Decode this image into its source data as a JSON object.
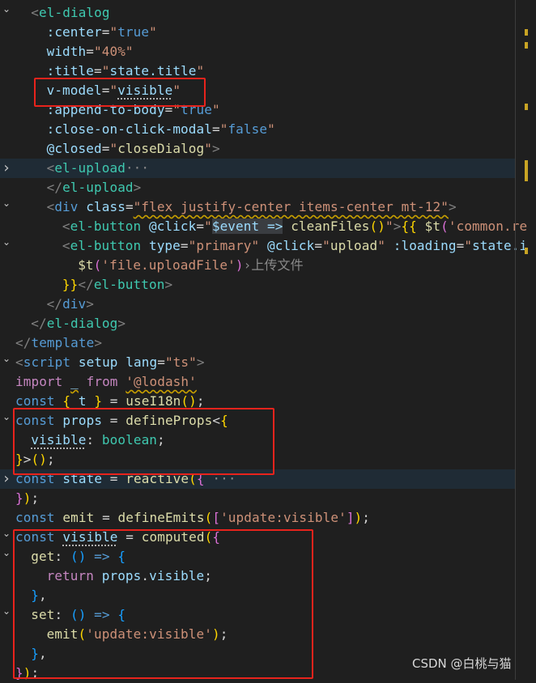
{
  "editor": {
    "lines": [
      {
        "f": "open",
        "i": 2,
        "t": [
          [
            "<",
            "g"
          ],
          [
            "el-dialog",
            "tag"
          ]
        ]
      },
      {
        "i": 4,
        "t": [
          [
            ":center",
            "attr"
          ],
          [
            "=",
            "pl"
          ],
          [
            "\"",
            "str"
          ],
          [
            "true",
            "kw"
          ],
          [
            "\"",
            "str"
          ]
        ]
      },
      {
        "i": 4,
        "t": [
          [
            "width",
            "attr"
          ],
          [
            "=",
            "pl"
          ],
          [
            "\"40%\"",
            "str"
          ]
        ]
      },
      {
        "i": 4,
        "t": [
          [
            ":title",
            "attr"
          ],
          [
            "=",
            "pl"
          ],
          [
            "\"",
            "str"
          ],
          [
            "state.title",
            "var"
          ],
          [
            "\"",
            "str"
          ]
        ]
      },
      {
        "i": 4,
        "t": [
          [
            "v-model",
            "attr"
          ],
          [
            "=",
            "pl"
          ],
          [
            "\"",
            "str"
          ],
          [
            "visible",
            "var dot"
          ],
          [
            "\"",
            "str"
          ]
        ]
      },
      {
        "i": 4,
        "t": [
          [
            ":append-to-body",
            "attr"
          ],
          [
            "=",
            "pl"
          ],
          [
            "\"",
            "str"
          ],
          [
            "true",
            "kw"
          ],
          [
            "\"",
            "str"
          ]
        ]
      },
      {
        "i": 4,
        "t": [
          [
            ":close-on-click-modal",
            "attr"
          ],
          [
            "=",
            "pl"
          ],
          [
            "\"",
            "str"
          ],
          [
            "false",
            "kw"
          ],
          [
            "\"",
            "str"
          ]
        ]
      },
      {
        "i": 4,
        "t": [
          [
            "@closed",
            "attr"
          ],
          [
            "=",
            "pl"
          ],
          [
            "\"",
            "str"
          ],
          [
            "closeDialog",
            "fn"
          ],
          [
            "\"",
            "str"
          ],
          [
            ">",
            "g"
          ]
        ]
      },
      {
        "f": "closed",
        "hl": true,
        "i": 4,
        "t": [
          [
            "<",
            "g"
          ],
          [
            "el-upload",
            "tag"
          ],
          [
            "···",
            "fold"
          ]
        ]
      },
      {
        "i": 4,
        "t": [
          [
            "</",
            "g"
          ],
          [
            "el-upload",
            "tag"
          ],
          [
            ">",
            "g"
          ]
        ]
      },
      {
        "f": "open",
        "i": 4,
        "t": [
          [
            "<",
            "g"
          ],
          [
            "div",
            "htag"
          ],
          [
            " ",
            "pl"
          ],
          [
            "class",
            "attr"
          ],
          [
            "=",
            "pl"
          ],
          [
            "\"flex justify-center items-center mt-12\"",
            "str sq"
          ],
          [
            ">",
            "g"
          ]
        ]
      },
      {
        "i": 6,
        "t": [
          [
            "<",
            "g"
          ],
          [
            "el-button",
            "tag"
          ],
          [
            " ",
            "pl"
          ],
          [
            "@click",
            "attr"
          ],
          [
            "=",
            "pl"
          ],
          [
            "\"",
            "str"
          ],
          [
            "$event =>",
            "var sel"
          ],
          [
            " ",
            "pl"
          ],
          [
            "cleanFiles",
            "fn"
          ],
          [
            "()",
            "b1"
          ],
          [
            "\"",
            "str"
          ],
          [
            ">",
            "g"
          ],
          [
            "{{",
            "b1"
          ],
          [
            " ",
            "pl"
          ],
          [
            "$t",
            "fn"
          ],
          [
            "(",
            "b2"
          ],
          [
            "'common.re",
            "str"
          ]
        ]
      },
      {
        "f": "open",
        "i": 6,
        "t": [
          [
            "<",
            "g"
          ],
          [
            "el-button",
            "tag"
          ],
          [
            " ",
            "pl"
          ],
          [
            "type",
            "attr"
          ],
          [
            "=",
            "pl"
          ],
          [
            "\"primary\"",
            "str"
          ],
          [
            " ",
            "pl"
          ],
          [
            "@click",
            "attr"
          ],
          [
            "=",
            "pl"
          ],
          [
            "\"",
            "str"
          ],
          [
            "upload",
            "fn"
          ],
          [
            "\"",
            "str"
          ],
          [
            " ",
            "pl"
          ],
          [
            ":loading",
            "attr"
          ],
          [
            "=",
            "pl"
          ],
          [
            "\"",
            "str"
          ],
          [
            "state.i",
            "var"
          ]
        ]
      },
      {
        "i": 8,
        "t": [
          [
            "$t",
            "fn"
          ],
          [
            "(",
            "b2"
          ],
          [
            "'file.uploadFile'",
            "str"
          ],
          [
            ")",
            "b2"
          ],
          [
            "›",
            "inlay"
          ],
          [
            "上传文件",
            "inlay"
          ]
        ]
      },
      {
        "i": 6,
        "t": [
          [
            "}}",
            "b1"
          ],
          [
            "</",
            "g"
          ],
          [
            "el-button",
            "tag"
          ],
          [
            ">",
            "g"
          ]
        ]
      },
      {
        "i": 4,
        "t": [
          [
            "</",
            "g"
          ],
          [
            "div",
            "htag"
          ],
          [
            ">",
            "g"
          ]
        ]
      },
      {
        "i": 2,
        "t": [
          [
            "</",
            "g"
          ],
          [
            "el-dialog",
            "tag"
          ],
          [
            ">",
            "g"
          ]
        ]
      },
      {
        "i": 0,
        "t": [
          [
            "</",
            "g"
          ],
          [
            "template",
            "htag"
          ],
          [
            ">",
            "g"
          ]
        ]
      },
      {
        "f": "open",
        "i": 0,
        "t": [
          [
            "<",
            "g"
          ],
          [
            "script",
            "htag"
          ],
          [
            " ",
            "pl"
          ],
          [
            "setup",
            "attr"
          ],
          [
            " ",
            "pl"
          ],
          [
            "lang",
            "attr"
          ],
          [
            "=",
            "pl"
          ],
          [
            "\"ts\"",
            "str"
          ],
          [
            ">",
            "g"
          ]
        ]
      },
      {
        "i": 0,
        "t": [
          [
            "import",
            "ctl"
          ],
          [
            " ",
            "pl"
          ],
          [
            "_",
            "var sq"
          ],
          [
            " ",
            "pl"
          ],
          [
            "from",
            "ctl"
          ],
          [
            " ",
            "pl"
          ],
          [
            "'@lodash'",
            "str sq"
          ]
        ]
      },
      {
        "i": 0,
        "t": [
          [
            "const",
            "kw"
          ],
          [
            " ",
            "pl"
          ],
          [
            "{",
            "b1"
          ],
          [
            " t ",
            "var"
          ],
          [
            "}",
            "b1"
          ],
          [
            " = ",
            "pl"
          ],
          [
            "useI18n",
            "fn"
          ],
          [
            "()",
            "b1"
          ],
          [
            ";",
            "pl"
          ]
        ]
      },
      {
        "f": "open",
        "i": 0,
        "t": [
          [
            "const",
            "kw"
          ],
          [
            " ",
            "pl"
          ],
          [
            "props",
            "var"
          ],
          [
            " = ",
            "pl"
          ],
          [
            "defineProps",
            "fn"
          ],
          [
            "<",
            "pl"
          ],
          [
            "{",
            "b1"
          ]
        ]
      },
      {
        "i": 2,
        "t": [
          [
            "visible",
            "var dot"
          ],
          [
            ": ",
            "pl"
          ],
          [
            "boolean",
            "tag"
          ],
          [
            ";",
            "pl"
          ]
        ]
      },
      {
        "i": 0,
        "t": [
          [
            "}",
            "b1"
          ],
          [
            ">",
            "pl"
          ],
          [
            "()",
            "b1"
          ],
          [
            ";",
            "pl"
          ]
        ]
      },
      {
        "f": "closed",
        "hl": true,
        "i": 0,
        "t": [
          [
            "const",
            "kw"
          ],
          [
            " ",
            "pl"
          ],
          [
            "state",
            "var"
          ],
          [
            " = ",
            "pl"
          ],
          [
            "reactive",
            "fn"
          ],
          [
            "(",
            "b1"
          ],
          [
            "{",
            "b2"
          ],
          [
            " ···",
            "fold"
          ]
        ]
      },
      {
        "i": 0,
        "t": [
          [
            "}",
            "b2"
          ],
          [
            ")",
            "b1"
          ],
          [
            ";",
            "pl"
          ]
        ]
      },
      {
        "i": 0,
        "t": [
          [
            "const",
            "kw"
          ],
          [
            " ",
            "pl"
          ],
          [
            "emit",
            "fn"
          ],
          [
            " = ",
            "pl"
          ],
          [
            "defineEmits",
            "fn"
          ],
          [
            "(",
            "b1"
          ],
          [
            "[",
            "b2"
          ],
          [
            "'update:visible'",
            "str"
          ],
          [
            "]",
            "b2"
          ],
          [
            ")",
            "b1"
          ],
          [
            ";",
            "pl"
          ]
        ]
      },
      {
        "f": "open",
        "i": 0,
        "t": [
          [
            "const",
            "kw"
          ],
          [
            " ",
            "pl"
          ],
          [
            "visible",
            "var dot"
          ],
          [
            " = ",
            "pl"
          ],
          [
            "computed",
            "fn"
          ],
          [
            "(",
            "b1"
          ],
          [
            "{",
            "b2"
          ]
        ]
      },
      {
        "f": "open",
        "i": 2,
        "t": [
          [
            "get",
            "fn"
          ],
          [
            ": ",
            "pl"
          ],
          [
            "()",
            "b3"
          ],
          [
            " => ",
            "kw"
          ],
          [
            "{",
            "b3"
          ]
        ]
      },
      {
        "i": 4,
        "t": [
          [
            "return",
            "ctl"
          ],
          [
            " ",
            "pl"
          ],
          [
            "props",
            "var"
          ],
          [
            ".",
            "pl"
          ],
          [
            "visible",
            "var"
          ],
          [
            ";",
            "pl"
          ]
        ]
      },
      {
        "i": 2,
        "t": [
          [
            "}",
            "b3"
          ],
          [
            ",",
            "pl"
          ]
        ]
      },
      {
        "f": "open",
        "i": 2,
        "t": [
          [
            "set",
            "fn"
          ],
          [
            ": ",
            "pl"
          ],
          [
            "()",
            "b3"
          ],
          [
            " => ",
            "kw"
          ],
          [
            "{",
            "b3"
          ]
        ]
      },
      {
        "i": 4,
        "t": [
          [
            "emit",
            "fn"
          ],
          [
            "(",
            "b1"
          ],
          [
            "'update:visible'",
            "str"
          ],
          [
            ")",
            "b1"
          ],
          [
            ";",
            "pl"
          ]
        ]
      },
      {
        "i": 2,
        "t": [
          [
            "}",
            "b3"
          ],
          [
            ",",
            "pl"
          ]
        ]
      },
      {
        "i": 0,
        "t": [
          [
            "}",
            "b2"
          ],
          [
            ")",
            "b1"
          ],
          [
            ";",
            "pl"
          ]
        ]
      }
    ]
  },
  "icons": {
    "fold_open": "chevron-down-icon",
    "fold_closed": "chevron-right-icon"
  },
  "colors": {
    "background": "#1f1f1f",
    "highlight_box": "#e8231c"
  },
  "watermark": "CSDN @白桃与猫"
}
